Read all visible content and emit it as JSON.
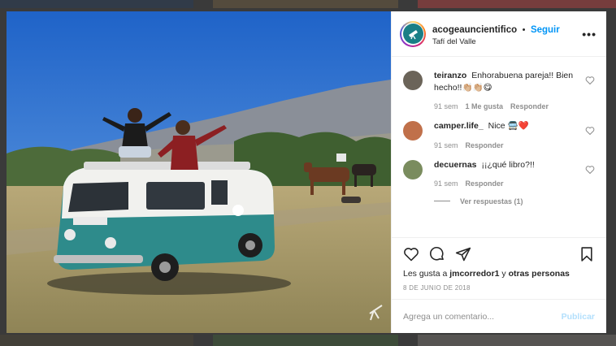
{
  "post": {
    "username": "acogeauncientifico",
    "separator": "•",
    "follow_label": "Seguir",
    "location": "Tafí del Valle",
    "more_label": "•••",
    "likes_prefix": "Les gusta a",
    "likes_user": "jmcorredor1",
    "likes_suffix": "y",
    "likes_others": "otras personas",
    "date": "8 DE JUNIO DE 2018"
  },
  "comments": [
    {
      "user": "teiranzo",
      "text": "Enhorabuena pareja!! Bien hecho!!👏🏼👏🏼😋",
      "time": "91 sem",
      "likes": "1 Me gusta",
      "reply": "Responder",
      "avatar_color": "#6b6459"
    },
    {
      "user": "camper.life_",
      "text": "Nice 🚍❤️",
      "time": "91 sem",
      "reply": "Responder",
      "avatar_color": "#c0704a"
    },
    {
      "user": "decuernas",
      "text": "¡¡¿qué libro?!!",
      "time": "91 sem",
      "reply": "Responder",
      "avatar_color": "#7a8c5e"
    }
  ],
  "view_replies": "Ver respuestas (1)",
  "composer": {
    "placeholder": "Agrega un comentario...",
    "publish_label": "Publicar"
  },
  "colors": {
    "accent": "#0095f6",
    "publish_disabled": "#b2dffc",
    "van_teal": "#2e8b8b",
    "sky": "#2a6fd0"
  }
}
